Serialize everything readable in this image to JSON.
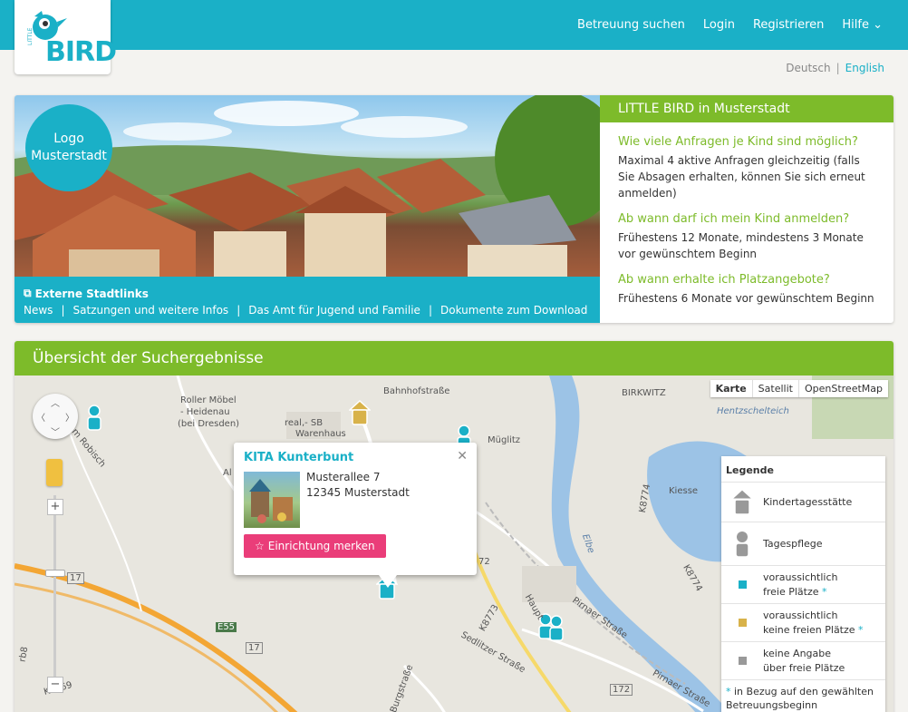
{
  "brand": {
    "logo_word": "BIRD",
    "logo_small": "LITTLE"
  },
  "nav": [
    {
      "label": "Betreuung suchen"
    },
    {
      "label": "Login"
    },
    {
      "label": "Registrieren"
    },
    {
      "label": "Hilfe"
    }
  ],
  "languages": {
    "de": "Deutsch",
    "en": "English",
    "active": "English"
  },
  "hero": {
    "logo_line1": "Logo",
    "logo_line2": "Musterstadt",
    "external_title": "Externe Stadtlinks",
    "links": [
      "News",
      "Satzungen und weitere Infos",
      "Das Amt für Jugend und Familie",
      "Dokumente zum Download"
    ]
  },
  "faq": {
    "title": "LITTLE BIRD in Musterstadt",
    "items": [
      {
        "q": "Wie viele Anfragen je Kind sind möglich?",
        "a": "Maximal 4 aktive Anfragen gleichzeitig (falls Sie Absagen erhalten, können Sie sich erneut anmelden)"
      },
      {
        "q": "Ab wann darf ich mein Kind anmelden?",
        "a": "Frühestens 12 Monate, mindestens 3 Monate vor gewünschtem Beginn"
      },
      {
        "q": "Ab wann erhalte ich Platzangebote?",
        "a": "Frühestens 6 Monate vor gewünschtem Beginn"
      }
    ]
  },
  "results": {
    "title": "Übersicht der Suchergebnisse",
    "map_types": [
      "Karte",
      "Satellit",
      "OpenStreetMap"
    ],
    "active_map_type": "Karte",
    "popup": {
      "title": "KITA Kunterbunt",
      "street": "Musterallee 7",
      "city": "12345 Musterstadt",
      "button": "Einrichtung merken"
    },
    "legend": {
      "title": "Legende",
      "kita": "Kindertagesstätte",
      "pflege": "Tagespflege",
      "free_1": "voraussichtlich",
      "free_2": "freie Plätze",
      "nofree_1": "voraussichtlich",
      "nofree_2": "keine freien Plätze",
      "none_1": "keine Angabe",
      "none_2": "über freie Plätze",
      "asterisk": "*",
      "footnote": "in Bezug auf den gewählten Betreuungsbeginn"
    },
    "map_labels": {
      "roller": "Roller Möbel",
      "heidenau": "- Heidenau",
      "dresden": "(bei Dresden)",
      "real1": "real,- SB",
      "real2": "Warenhaus",
      "bahnhof": "Bahnhofstraße",
      "birkwitz": "BIRKWITZ",
      "hentzschel": "Hentzschelteich",
      "elbe": "Elbe",
      "pirnaer1": "Pirnaer Straße",
      "pirnaer2": "Pirnaer Straße",
      "sedlitzer": "Sedlitzer Straße",
      "burgstrasse": "Burgstraße",
      "k8773": "K8773",
      "k8774": "K8774",
      "k8774b": "K8774",
      "k8169": "K8169",
      "e55": "E55",
      "r17a": "17",
      "r17b": "17",
      "r172": "172",
      "r72": "72",
      "hauptstr": "Haupt",
      "mueglitz": "Müglitz",
      "amrobisch": "Am Robisch",
      "kiesse": "Kiesse",
      "al": "Al",
      "rb8": "rb8"
    },
    "colors": {
      "free": "#1ab0c7",
      "nofree": "#d8b24a",
      "none": "#999999"
    }
  }
}
